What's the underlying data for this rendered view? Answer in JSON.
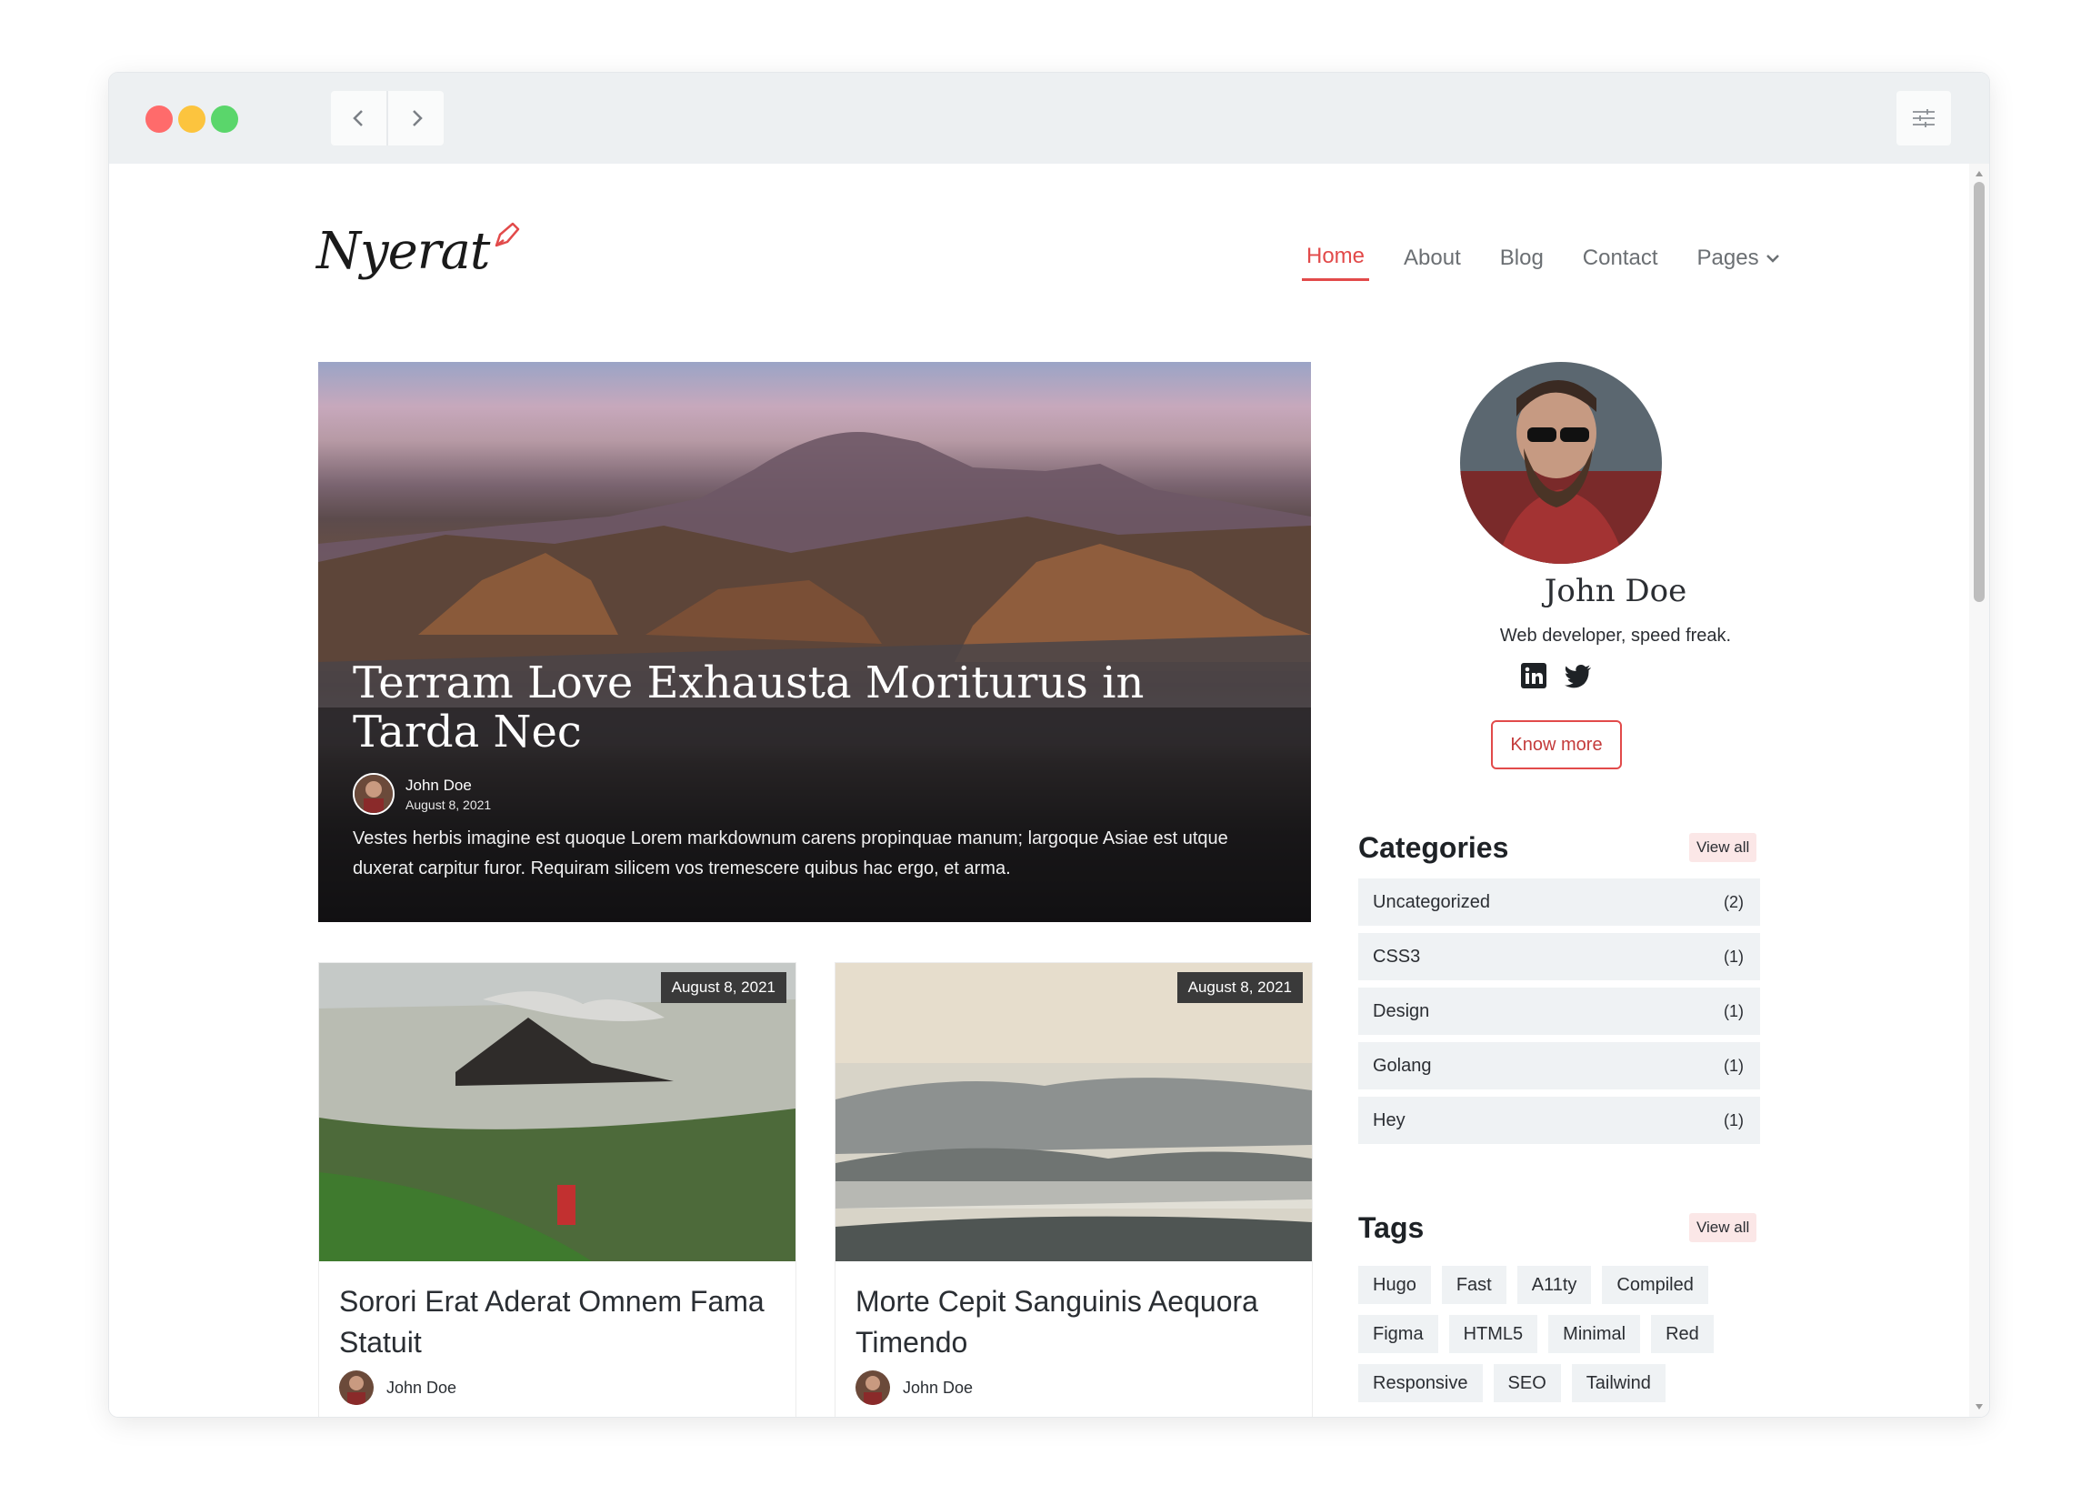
{
  "browser": {
    "back_label": "‹",
    "forward_label": "›",
    "icons": {
      "back": "chevron-left-icon",
      "forward": "chevron-right-icon",
      "settings": "sliders-icon"
    }
  },
  "site": {
    "logo_text": "Nyerat",
    "nav": [
      {
        "label": "Home",
        "active": true
      },
      {
        "label": "About"
      },
      {
        "label": "Blog"
      },
      {
        "label": "Contact"
      },
      {
        "label": "Pages"
      }
    ],
    "accent_color": "#e24a4a"
  },
  "featured": {
    "title": "Terram Love Exhausta Moriturus in Tarda Nec",
    "author": "John Doe",
    "date": "August 8, 2021",
    "excerpt": "Vestes herbis imagine est quoque Lorem markdownum carens propinquae manum; largoque Asiae est utque duxerat carpitur furor. Requiram silicem vos tremescere quibus hac ergo, et arma."
  },
  "posts": [
    {
      "date": "August 8, 2021",
      "title": "Sorori Erat Aderat Omnem Fama Statuit",
      "author": "John Doe"
    },
    {
      "date": "August 8, 2021",
      "title": "Morte Cepit Sanguinis Aequora Timendo",
      "author": "John Doe"
    }
  ],
  "profile": {
    "name": "John Doe",
    "bio": "Web developer, speed freak.",
    "button": "Know more",
    "social": [
      "linkedin-icon",
      "twitter-icon"
    ]
  },
  "categories": {
    "heading": "Categories",
    "view_all": "View all",
    "items": [
      {
        "name": "Uncategorized",
        "count": "(2)"
      },
      {
        "name": "CSS3",
        "count": "(1)"
      },
      {
        "name": "Design",
        "count": "(1)"
      },
      {
        "name": "Golang",
        "count": "(1)"
      },
      {
        "name": "Hey",
        "count": "(1)"
      }
    ]
  },
  "tags": {
    "heading": "Tags",
    "view_all": "View all",
    "items": [
      "Hugo",
      "Fast",
      "A11ty",
      "Compiled",
      "Figma",
      "HTML5",
      "Minimal",
      "Red",
      "Responsive",
      "SEO",
      "Tailwind"
    ]
  }
}
